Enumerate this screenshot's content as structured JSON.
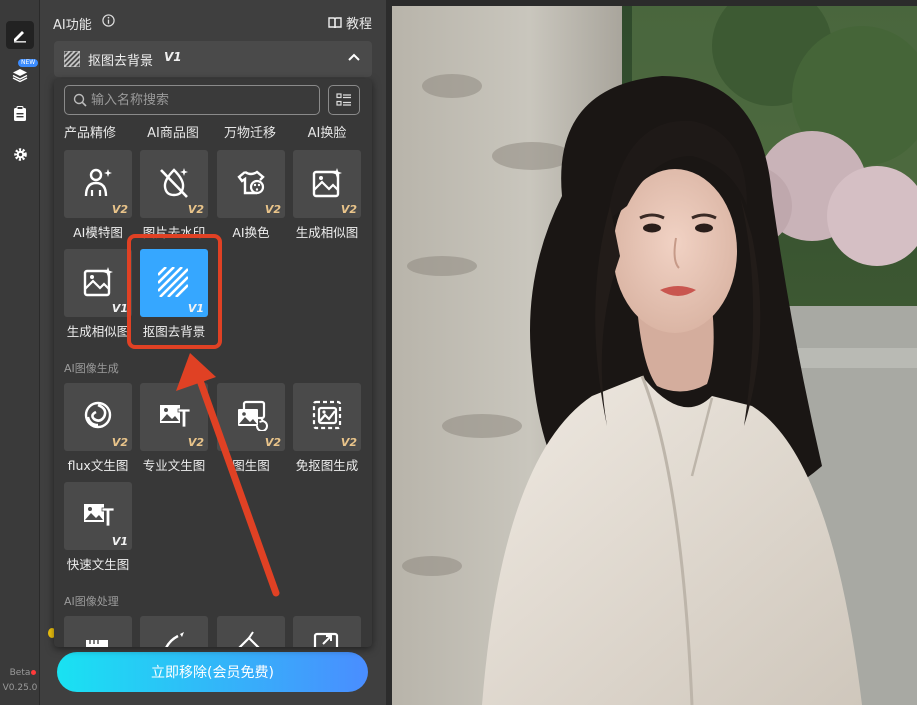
{
  "app": {
    "panel_title": "AI功能",
    "tutorial_label": "教程",
    "new_badge": "NEW",
    "beta_label": "Beta",
    "version": "V0.25.0"
  },
  "feature_bar": {
    "label": "抠图去背景",
    "version": "V1"
  },
  "search": {
    "placeholder": "输入名称搜索"
  },
  "categories": [
    "产品精修",
    "AI商品图",
    "万物迁移",
    "AI换脸"
  ],
  "sections": {
    "generate": "AI图像生成",
    "process": "AI图像处理"
  },
  "tiles_row1": [
    {
      "label": "AI模特图",
      "version": "V2",
      "icon": "person-sparkle-icon"
    },
    {
      "label": "图片去水印",
      "version": "V2",
      "icon": "no-watermark-icon"
    },
    {
      "label": "AI换色",
      "version": "V2",
      "icon": "shirt-palette-icon"
    },
    {
      "label": "生成相似图",
      "version": "V2",
      "icon": "image-sparkle-icon"
    }
  ],
  "tiles_row2": [
    {
      "label": "生成相似图",
      "version": "V1",
      "icon": "image-sparkle-icon"
    },
    {
      "label": "抠图去背景",
      "version": "V1",
      "icon": "stripes-icon"
    }
  ],
  "tiles_gen_row1": [
    {
      "label": "flux文生图",
      "version": "V2",
      "icon": "swirl-icon"
    },
    {
      "label": "专业文生图",
      "version": "V2",
      "icon": "image-text-icon"
    },
    {
      "label": "图生图",
      "version": "V2",
      "icon": "image-to-image-icon"
    },
    {
      "label": "免抠图生成",
      "version": "V2",
      "icon": "dashed-image-icon"
    }
  ],
  "tiles_gen_row2": [
    {
      "label": "快速文生图",
      "version": "V1",
      "icon": "image-text-icon"
    }
  ],
  "cta_label": "立即移除(会员免费)",
  "colors": {
    "accent": "#36a7ff",
    "highlight": "#e04124",
    "cta_start": "#19e2f2",
    "cta_end": "#4a8dff",
    "version_badge": "#e9c48a"
  }
}
